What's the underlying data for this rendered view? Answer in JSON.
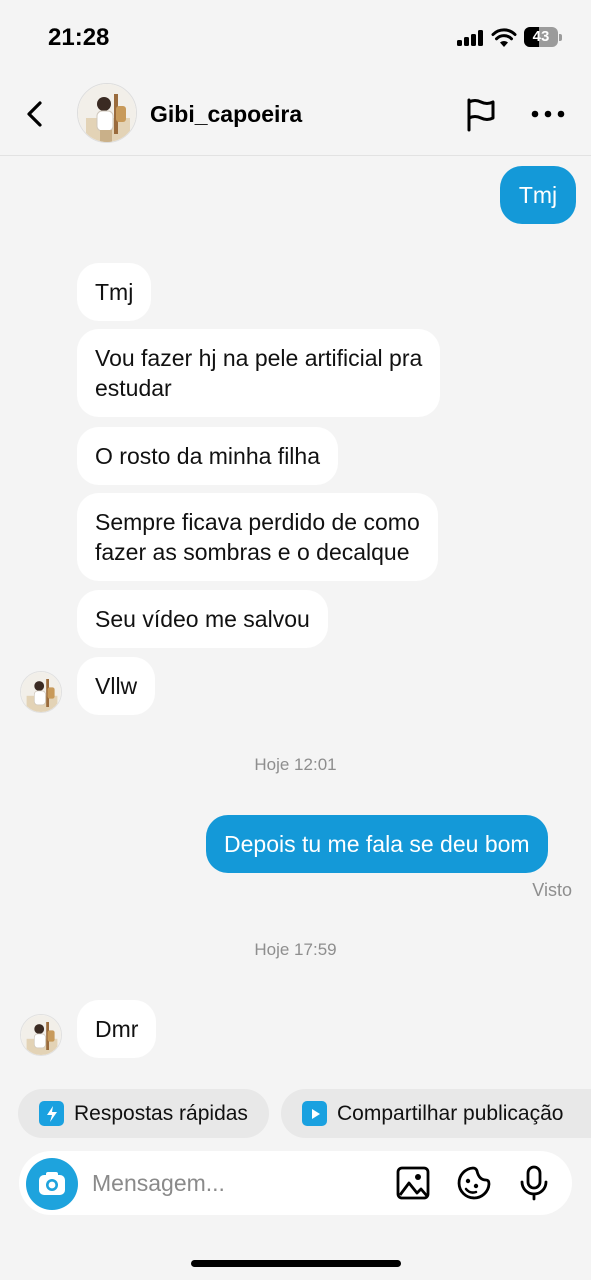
{
  "status_bar": {
    "time": "21:28",
    "battery": "43",
    "battery_level": 0.43
  },
  "header": {
    "contact_name": "Gibi_capoeira"
  },
  "messages": [
    {
      "text": "Tmj"
    },
    {
      "text": "Tmj"
    },
    {
      "line1": "Vou fazer hj na pele artificial pra",
      "line2": "estudar"
    },
    {
      "text": "O rosto da minha filha"
    },
    {
      "line1": "Sempre ficava perdido de como",
      "line2": "fazer as sombras e o decalque"
    },
    {
      "text": "Seu vídeo me salvou"
    },
    {
      "text": "Vllw"
    },
    {
      "text": "Depois tu me fala se deu bom"
    },
    {
      "text": "Dmr"
    }
  ],
  "timestamps": [
    "Hoje 12:01",
    "Hoje 17:59"
  ],
  "seen_label": "Visto",
  "quick_actions": {
    "quick_replies": "Respostas rápidas",
    "share_post": "Compartilhar publicação"
  },
  "composer": {
    "placeholder": "Mensagem..."
  },
  "colors": {
    "outgoing_bubble": "#1499d8",
    "incoming_bubble": "#ffffff",
    "accent": "#1ea3dd",
    "background": "#f4f4f4"
  },
  "icons": [
    "back-arrow-icon",
    "flag-icon",
    "more-icon",
    "camera-icon",
    "gallery-icon",
    "sticker-icon",
    "microphone-icon",
    "lightning-icon",
    "play-icon"
  ]
}
